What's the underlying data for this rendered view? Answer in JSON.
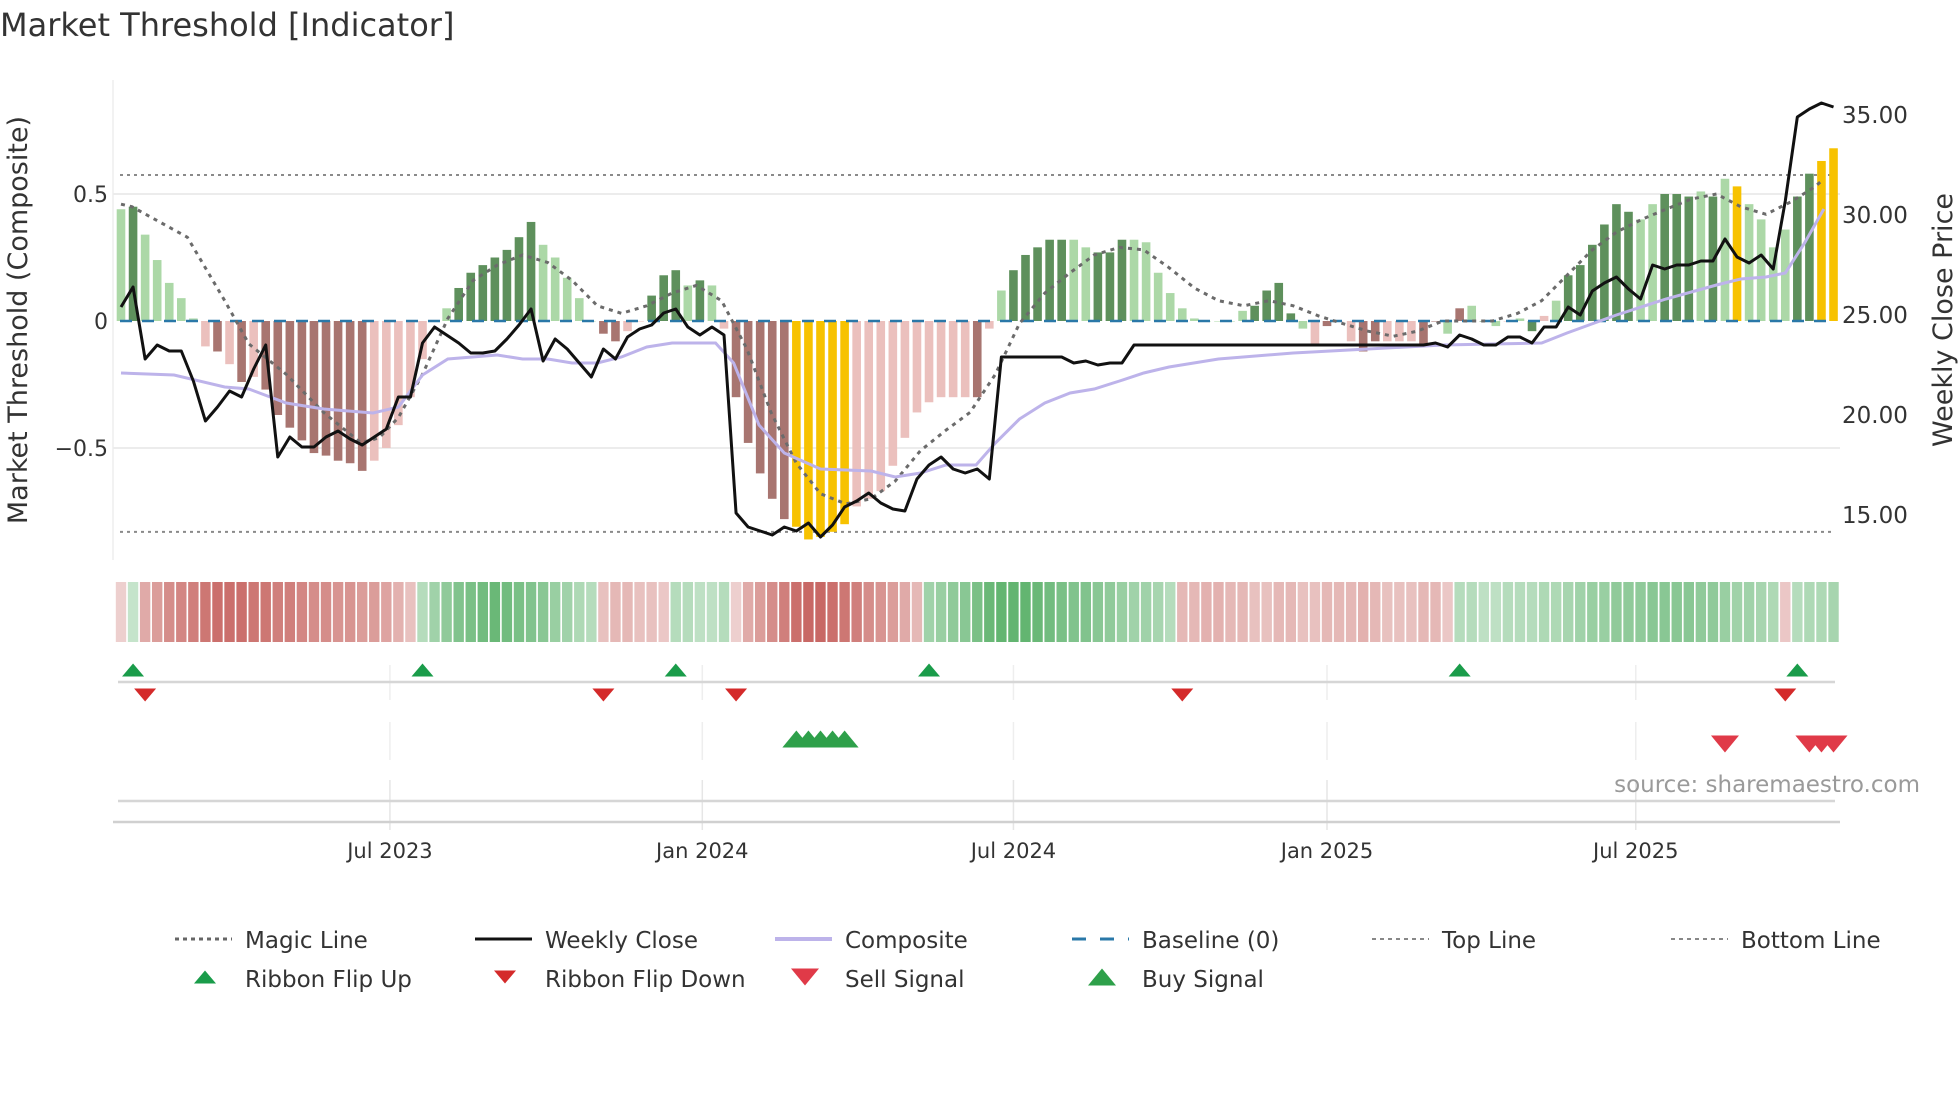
{
  "chart_data": {
    "type": "bar",
    "title": "Market Threshold [Indicator]",
    "left_axis": {
      "label": "Market Threshold (Composite)",
      "ticks": [
        0.5,
        0,
        -0.5
      ],
      "tick_labels": [
        "0.5",
        "0",
        "−0.5"
      ],
      "range": [
        -0.92,
        0.95
      ]
    },
    "right_axis": {
      "label": "Weekly Close Price",
      "ticks": [
        35,
        30,
        25,
        20,
        15
      ],
      "tick_labels": [
        "35.00",
        "30.00",
        "25.00",
        "20.00",
        "15.00"
      ]
    },
    "x_ticks": [
      {
        "label": "Jul 2023",
        "week": 22.3
      },
      {
        "label": "Jan 2024",
        "week": 48.2
      },
      {
        "label": "Jul 2024",
        "week": 74.0
      },
      {
        "label": "Jan 2025",
        "week": 100.0
      },
      {
        "label": "Jul 2025",
        "week": 125.6
      }
    ],
    "weeks": 143,
    "composite_bars": {
      "values": [
        0.44,
        0.45,
        0.34,
        0.24,
        0.15,
        0.09,
        0.01,
        -0.1,
        -0.12,
        -0.17,
        -0.24,
        -0.22,
        -0.27,
        -0.37,
        -0.42,
        -0.47,
        -0.52,
        -0.53,
        -0.55,
        -0.56,
        -0.59,
        -0.55,
        -0.5,
        -0.41,
        -0.3,
        -0.15,
        0,
        0.05,
        0.13,
        0.19,
        0.22,
        0.25,
        0.28,
        0.33,
        0.39,
        0.3,
        0.25,
        0.17,
        0.09,
        0,
        -0.05,
        -0.08,
        -0.04,
        0,
        0.1,
        0.18,
        0.2,
        0.14,
        0.16,
        0.14,
        -0.03,
        -0.3,
        -0.48,
        -0.6,
        -0.7,
        -0.78,
        -0.81,
        -0.86,
        -0.85,
        -0.83,
        -0.8,
        -0.73,
        -0.7,
        -0.67,
        -0.57,
        -0.46,
        -0.36,
        -0.32,
        -0.3,
        -0.3,
        -0.3,
        -0.3,
        -0.03,
        0.12,
        0.2,
        0.26,
        0.29,
        0.32,
        0.32,
        0.32,
        0.29,
        0.27,
        0.27,
        0.32,
        0.32,
        0.31,
        0.19,
        0.11,
        0.05,
        0.01,
        0,
        0,
        0,
        0.04,
        0.06,
        0.12,
        0.15,
        0.03,
        -0.03,
        -0.09,
        -0.02,
        0,
        -0.08,
        -0.12,
        -0.08,
        -0.08,
        -0.08,
        -0.08,
        -0.09,
        0,
        -0.05,
        0.05,
        0.06,
        0,
        -0.02,
        0,
        0.01,
        -0.04,
        0.02,
        0.08,
        0.18,
        0.22,
        0.3,
        0.38,
        0.46,
        0.43,
        0.4,
        0.46,
        0.5,
        0.5,
        0.49,
        0.51,
        0.49,
        0.56,
        0.53,
        0.46,
        0.4,
        0.29,
        0.36,
        0.49,
        0.58,
        0.63,
        0.68
      ],
      "strength": "LDLLLLLPRPRPRRRRRRRRRPPPPPLLDDDDDDDLLLLLRRPPDDDLDLPRRRRRYYYYYPPPPPPPPPPRPLDDDDDLLDDDLLLLLLLLLLDDDDLPRPPRRPPPRRLRLDLPLDPLDDDDDDLLDDDLDLYLLLLDDYYY"
    },
    "weekly_close": [
      25.4,
      26.4,
      22.8,
      23.5,
      23.2,
      23.2,
      21.7,
      19.7,
      20.4,
      21.2,
      20.9,
      22.3,
      23.5,
      17.9,
      18.9,
      18.4,
      18.4,
      18.9,
      19.2,
      18.8,
      18.5,
      18.9,
      19.3,
      20.9,
      20.9,
      23.6,
      24.4,
      24.0,
      23.6,
      23.1,
      23.1,
      23.2,
      23.8,
      24.5,
      25.3,
      22.7,
      23.8,
      23.3,
      22.6,
      21.9,
      23.3,
      22.8,
      23.9,
      24.3,
      24.5,
      25.1,
      25.3,
      24.4,
      24.0,
      24.4,
      24.0,
      15.1,
      14.4,
      14.2,
      14.0,
      14.4,
      14.2,
      14.6,
      13.9,
      14.5,
      15.4,
      15.7,
      16.1,
      15.6,
      15.3,
      15.2,
      16.8,
      17.5,
      17.9,
      17.3,
      17.1,
      17.3,
      16.8,
      22.9,
      22.9,
      22.9,
      22.9,
      22.9,
      22.9,
      22.6,
      22.7,
      22.5,
      22.6,
      22.6,
      23.5,
      23.5,
      23.5,
      23.5,
      23.5,
      23.5,
      23.5,
      23.5,
      23.5,
      23.5,
      23.5,
      23.5,
      23.5,
      23.5,
      23.5,
      23.5,
      23.5,
      23.5,
      23.5,
      23.5,
      23.5,
      23.5,
      23.5,
      23.5,
      23.5,
      23.6,
      23.4,
      24.0,
      23.8,
      23.5,
      23.5,
      23.9,
      23.9,
      23.6,
      24.4,
      24.4,
      25.4,
      25.0,
      26.2,
      26.6,
      26.9,
      26.3,
      25.8,
      27.5,
      27.3,
      27.5,
      27.5,
      27.7,
      27.7,
      28.8,
      27.9,
      27.6,
      28.0,
      27.3,
      30.7,
      34.9,
      35.3,
      35.6,
      35.4
    ],
    "magic_line": [
      [
        0,
        0.46
      ],
      [
        0.9,
        0.45
      ],
      [
        5.5,
        0.33
      ],
      [
        8.6,
        0.08
      ],
      [
        10.6,
        -0.09
      ],
      [
        13.7,
        -0.21
      ],
      [
        16.8,
        -0.36
      ],
      [
        19.9,
        -0.48
      ],
      [
        21.4,
        -0.46
      ],
      [
        23,
        -0.38
      ],
      [
        25,
        -0.21
      ],
      [
        27.1,
        0.01
      ],
      [
        29.2,
        0.16
      ],
      [
        31.2,
        0.22
      ],
      [
        33.3,
        0.26
      ],
      [
        35.4,
        0.23
      ],
      [
        37.4,
        0.16
      ],
      [
        39.5,
        0.06
      ],
      [
        41.5,
        0.03
      ],
      [
        43.6,
        0.06
      ],
      [
        45.7,
        0.11
      ],
      [
        47.7,
        0.14
      ],
      [
        49.8,
        0.08
      ],
      [
        51.9,
        -0.11
      ],
      [
        53.9,
        -0.36
      ],
      [
        56,
        -0.56
      ],
      [
        58,
        -0.68
      ],
      [
        60.1,
        -0.72
      ],
      [
        62.2,
        -0.7
      ],
      [
        64.2,
        -0.63
      ],
      [
        66.3,
        -0.51
      ],
      [
        68.4,
        -0.43
      ],
      [
        70.4,
        -0.36
      ],
      [
        72.5,
        -0.21
      ],
      [
        74.5,
        -0.01
      ],
      [
        76.6,
        0.11
      ],
      [
        78.7,
        0.19
      ],
      [
        80.7,
        0.26
      ],
      [
        82.8,
        0.29
      ],
      [
        84.8,
        0.28
      ],
      [
        86.9,
        0.21
      ],
      [
        89,
        0.13
      ],
      [
        91,
        0.08
      ],
      [
        93.1,
        0.06
      ],
      [
        95.2,
        0.08
      ],
      [
        97.2,
        0.06
      ],
      [
        99.3,
        0.02
      ],
      [
        101.3,
        -0.01
      ],
      [
        103.4,
        -0.04
      ],
      [
        105.5,
        -0.06
      ],
      [
        107.5,
        -0.04
      ],
      [
        109.6,
        0
      ],
      [
        113.7,
        0
      ],
      [
        115.8,
        0.03
      ],
      [
        117.8,
        0.08
      ],
      [
        119.9,
        0.18
      ],
      [
        122,
        0.28
      ],
      [
        124,
        0.35
      ],
      [
        126.1,
        0.4
      ],
      [
        128.1,
        0.44
      ],
      [
        130.2,
        0.48
      ],
      [
        132.3,
        0.5
      ],
      [
        134.3,
        0.45
      ],
      [
        136.4,
        0.42
      ],
      [
        138.5,
        0.47
      ],
      [
        140.5,
        0.53
      ],
      [
        141.2,
        0.56
      ]
    ],
    "composite_line": [
      [
        0,
        22.1
      ],
      [
        4.4,
        22.0
      ],
      [
        8.6,
        21.4
      ],
      [
        10.6,
        21.3
      ],
      [
        13.7,
        20.6
      ],
      [
        16.8,
        20.3
      ],
      [
        20.9,
        20.1
      ],
      [
        23,
        20.4
      ],
      [
        25,
        22.0
      ],
      [
        27.1,
        22.8
      ],
      [
        31.2,
        23.0
      ],
      [
        33.3,
        22.8
      ],
      [
        35.4,
        22.8
      ],
      [
        37.4,
        22.6
      ],
      [
        39.5,
        22.6
      ],
      [
        41.5,
        22.9
      ],
      [
        43.6,
        23.4
      ],
      [
        45.7,
        23.6
      ],
      [
        49.3,
        23.6
      ],
      [
        50.8,
        22.6
      ],
      [
        52.9,
        19.5
      ],
      [
        55,
        18.1
      ],
      [
        58,
        17.3
      ],
      [
        62.2,
        17.2
      ],
      [
        64.2,
        16.9
      ],
      [
        66.3,
        17.1
      ],
      [
        68.4,
        17.5
      ],
      [
        70.9,
        17.5
      ],
      [
        72.5,
        18.6
      ],
      [
        74.5,
        19.8
      ],
      [
        76.6,
        20.6
      ],
      [
        78.7,
        21.1
      ],
      [
        80.7,
        21.3
      ],
      [
        82.8,
        21.7
      ],
      [
        84.8,
        22.1
      ],
      [
        86.9,
        22.4
      ],
      [
        91,
        22.8
      ],
      [
        97.2,
        23.1
      ],
      [
        103.4,
        23.3
      ],
      [
        109.6,
        23.5
      ],
      [
        117.8,
        23.6
      ],
      [
        119.9,
        24.1
      ],
      [
        124,
        25.0
      ],
      [
        128.1,
        25.8
      ],
      [
        132.3,
        26.5
      ],
      [
        134.3,
        26.8
      ],
      [
        136.4,
        26.9
      ],
      [
        138,
        27.1
      ],
      [
        139.6,
        28.6
      ],
      [
        141.2,
        30.3
      ]
    ],
    "baseline": 0,
    "top_line": 0.575,
    "bottom_line": -0.83,
    "ribbon": [
      -0.15,
      0.2,
      -0.4,
      -0.5,
      -0.6,
      -0.65,
      -0.7,
      -0.75,
      -0.8,
      -0.8,
      -0.8,
      -0.75,
      -0.75,
      -0.7,
      -0.7,
      -0.65,
      -0.6,
      -0.6,
      -0.55,
      -0.55,
      -0.5,
      -0.5,
      -0.45,
      -0.35,
      -0.25,
      0.3,
      0.45,
      0.55,
      0.65,
      0.7,
      0.75,
      0.8,
      0.75,
      0.7,
      0.65,
      0.6,
      0.5,
      0.45,
      0.35,
      0.3,
      -0.25,
      -0.3,
      -0.3,
      -0.25,
      -0.25,
      -0.2,
      0.3,
      0.3,
      0.25,
      0.25,
      0.3,
      -0.15,
      -0.4,
      -0.5,
      -0.6,
      -0.7,
      -0.8,
      -0.85,
      -0.85,
      -0.8,
      -0.75,
      -0.7,
      -0.6,
      -0.55,
      -0.5,
      -0.4,
      -0.3,
      0.45,
      0.5,
      0.55,
      0.6,
      0.7,
      0.8,
      0.85,
      0.85,
      0.85,
      0.8,
      0.75,
      0.7,
      0.65,
      0.65,
      0.6,
      0.55,
      0.5,
      0.45,
      0.45,
      0.4,
      0.3,
      -0.3,
      -0.3,
      -0.35,
      -0.35,
      -0.3,
      -0.3,
      -0.25,
      -0.25,
      -0.3,
      -0.3,
      -0.25,
      -0.25,
      -0.3,
      -0.3,
      -0.3,
      -0.35,
      -0.3,
      -0.25,
      -0.25,
      -0.25,
      -0.3,
      -0.3,
      -0.2,
      0.3,
      0.3,
      0.25,
      0.25,
      0.3,
      0.3,
      0.3,
      0.35,
      0.35,
      0.4,
      0.45,
      0.5,
      0.5,
      0.55,
      0.55,
      0.55,
      0.6,
      0.6,
      0.6,
      0.6,
      0.55,
      0.55,
      0.5,
      0.45,
      0.45,
      0.4,
      0.35,
      -0.2,
      0.3,
      0.35,
      0.35,
      0.4
    ],
    "ribbon_flip_up": [
      1,
      25,
      46,
      67,
      111,
      139
    ],
    "ribbon_flip_down": [
      2,
      40,
      51,
      88,
      138
    ],
    "buy_signals": [
      56,
      57,
      58,
      59,
      60
    ],
    "sell_signals": [
      133,
      140,
      141,
      142
    ],
    "legend": [
      {
        "label": "Magic Line",
        "style": "dotted",
        "color": "#666666"
      },
      {
        "label": "Weekly Close",
        "style": "solid",
        "color": "#111111"
      },
      {
        "label": "Composite",
        "style": "solid-thick",
        "color": "#bdb3ea"
      },
      {
        "label": "Baseline (0)",
        "style": "dashed",
        "color": "#2a78a8"
      },
      {
        "label": "Top Line",
        "style": "dotted-thin",
        "color": "#888888"
      },
      {
        "label": "Bottom Line",
        "style": "dotted-thin",
        "color": "#888888"
      },
      {
        "label": "Ribbon Flip Up",
        "style": "tri-up",
        "color": "#1a9c4a"
      },
      {
        "label": "Ribbon Flip Down",
        "style": "tri-down",
        "color": "#d42a2a"
      },
      {
        "label": "Sell Signal",
        "style": "tri-down-big",
        "color": "#e03a48"
      },
      {
        "label": "Buy Signal",
        "style": "tri-up-big",
        "color": "#2ea04a"
      }
    ],
    "colors": {
      "strong_up": "#5e905c",
      "weak_up": "#acd8a7",
      "strong_down": "#a87570",
      "weak_down": "#ebc0bd",
      "extreme": "#f7c200"
    },
    "source": "source: sharemaestro.com"
  }
}
